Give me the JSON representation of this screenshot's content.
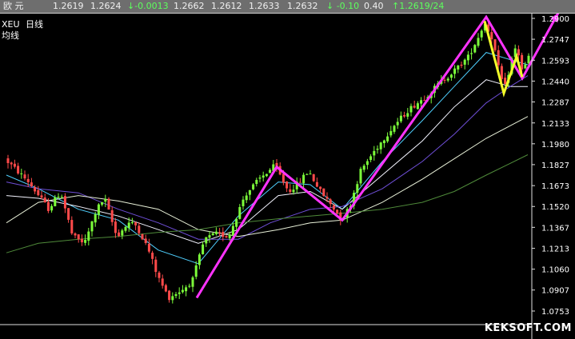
{
  "quote_bar": {
    "name": "欧  元",
    "fields": [
      "1.2619",
      "1.2624",
      "↓-0.0013",
      "1.2662",
      "1.2612",
      "1.2633",
      "1.2632",
      "↓ -0.10",
      "0.40",
      "↑1.2619/24"
    ]
  },
  "chart_data": {
    "type": "candlestick",
    "symbol": "XEU",
    "period": "日线",
    "sub_label": "均线",
    "y_ticks": [
      "1.2900",
      "1.2747",
      "1.2593",
      "1.2440",
      "1.2287",
      "1.2133",
      "1.1980",
      "1.1827",
      "1.1673",
      "1.1520",
      "1.1367",
      "1.1213",
      "1.1060",
      "1.0907",
      "1.0753"
    ],
    "ylim": [
      1.0753,
      1.29
    ],
    "price_path": [
      [
        0,
        1.187
      ],
      [
        30,
        1.17
      ],
      [
        55,
        1.15
      ],
      [
        70,
        1.163
      ],
      [
        85,
        1.13
      ],
      [
        100,
        1.125
      ],
      [
        115,
        1.15
      ],
      [
        125,
        1.158
      ],
      [
        140,
        1.13
      ],
      [
        155,
        1.14
      ],
      [
        165,
        1.138
      ],
      [
        180,
        1.12
      ],
      [
        192,
        1.1
      ],
      [
        205,
        1.085
      ],
      [
        225,
        1.092
      ],
      [
        235,
        1.098
      ],
      [
        250,
        1.128
      ],
      [
        265,
        1.132
      ],
      [
        280,
        1.13
      ],
      [
        300,
        1.16
      ],
      [
        320,
        1.173
      ],
      [
        338,
        1.182
      ],
      [
        355,
        1.163
      ],
      [
        365,
        1.168
      ],
      [
        380,
        1.178
      ],
      [
        395,
        1.163
      ],
      [
        410,
        1.152
      ],
      [
        422,
        1.142
      ],
      [
        432,
        1.153
      ],
      [
        445,
        1.178
      ],
      [
        465,
        1.195
      ],
      [
        485,
        1.21
      ],
      [
        505,
        1.223
      ],
      [
        525,
        1.232
      ],
      [
        545,
        1.243
      ],
      [
        565,
        1.253
      ],
      [
        580,
        1.262
      ],
      [
        592,
        1.276
      ],
      [
        600,
        1.287
      ],
      [
        610,
        1.275
      ],
      [
        618,
        1.252
      ],
      [
        625,
        1.238
      ],
      [
        635,
        1.262
      ],
      [
        640,
        1.27
      ],
      [
        648,
        1.25
      ],
      [
        655,
        1.262
      ]
    ],
    "moving_averages": [
      {
        "color": "#4fd0ff",
        "values": [
          [
            0,
            1.175
          ],
          [
            40,
            1.165
          ],
          [
            90,
            1.15
          ],
          [
            140,
            1.142
          ],
          [
            190,
            1.12
          ],
          [
            240,
            1.11
          ],
          [
            290,
            1.145
          ],
          [
            340,
            1.17
          ],
          [
            380,
            1.168
          ],
          [
            420,
            1.15
          ],
          [
            470,
            1.185
          ],
          [
            520,
            1.215
          ],
          [
            560,
            1.24
          ],
          [
            600,
            1.265
          ],
          [
            640,
            1.258
          ],
          [
            652,
            1.256
          ]
        ]
      },
      {
        "color": "#f4f4ff",
        "values": [
          [
            0,
            1.16
          ],
          [
            40,
            1.158
          ],
          [
            90,
            1.152
          ],
          [
            140,
            1.145
          ],
          [
            190,
            1.135
          ],
          [
            240,
            1.125
          ],
          [
            290,
            1.135
          ],
          [
            340,
            1.16
          ],
          [
            380,
            1.163
          ],
          [
            420,
            1.15
          ],
          [
            470,
            1.175
          ],
          [
            520,
            1.2
          ],
          [
            560,
            1.225
          ],
          [
            600,
            1.245
          ],
          [
            630,
            1.24
          ],
          [
            652,
            1.24
          ]
        ]
      },
      {
        "color": "#6f4fd8",
        "values": [
          [
            0,
            1.17
          ],
          [
            40,
            1.165
          ],
          [
            90,
            1.162
          ],
          [
            140,
            1.15
          ],
          [
            190,
            1.14
          ],
          [
            240,
            1.128
          ],
          [
            290,
            1.128
          ],
          [
            330,
            1.14
          ],
          [
            380,
            1.15
          ],
          [
            420,
            1.152
          ],
          [
            470,
            1.165
          ],
          [
            520,
            1.185
          ],
          [
            560,
            1.205
          ],
          [
            600,
            1.228
          ],
          [
            630,
            1.24
          ],
          [
            652,
            1.248
          ]
        ]
      },
      {
        "color": "#e8f0d8",
        "values": [
          [
            0,
            1.14
          ],
          [
            40,
            1.155
          ],
          [
            90,
            1.16
          ],
          [
            140,
            1.156
          ],
          [
            190,
            1.15
          ],
          [
            240,
            1.135
          ],
          [
            290,
            1.13
          ],
          [
            340,
            1.135
          ],
          [
            380,
            1.14
          ],
          [
            420,
            1.142
          ],
          [
            470,
            1.155
          ],
          [
            520,
            1.172
          ],
          [
            560,
            1.187
          ],
          [
            600,
            1.202
          ],
          [
            652,
            1.218
          ]
        ]
      },
      {
        "color": "#4f8a3a",
        "values": [
          [
            0,
            1.118
          ],
          [
            40,
            1.125
          ],
          [
            90,
            1.128
          ],
          [
            140,
            1.13
          ],
          [
            190,
            1.133
          ],
          [
            240,
            1.135
          ],
          [
            290,
            1.14
          ],
          [
            340,
            1.143
          ],
          [
            380,
            1.145
          ],
          [
            420,
            1.147
          ],
          [
            470,
            1.15
          ],
          [
            520,
            1.155
          ],
          [
            560,
            1.163
          ],
          [
            600,
            1.175
          ],
          [
            652,
            1.19
          ]
        ]
      }
    ],
    "pattern_lines": [
      {
        "color": "#ff33ff",
        "points": [
          [
            238,
            1.085
          ],
          [
            338,
            1.181
          ],
          [
            420,
            1.142
          ],
          [
            600,
            1.291
          ],
          [
            645,
            1.246
          ],
          [
            690,
            1.294
          ]
        ]
      },
      {
        "color": "#f4ff2a",
        "points": [
          [
            598,
            1.288
          ],
          [
            622,
            1.235
          ],
          [
            638,
            1.262
          ],
          [
            645,
            1.247
          ]
        ]
      }
    ]
  },
  "watermark": "KEKSOFT.COM",
  "colors": {
    "up": "#7cff3a",
    "down": "#ff4a4a",
    "axis": "#e0e0e0",
    "text": "#ffffff"
  }
}
